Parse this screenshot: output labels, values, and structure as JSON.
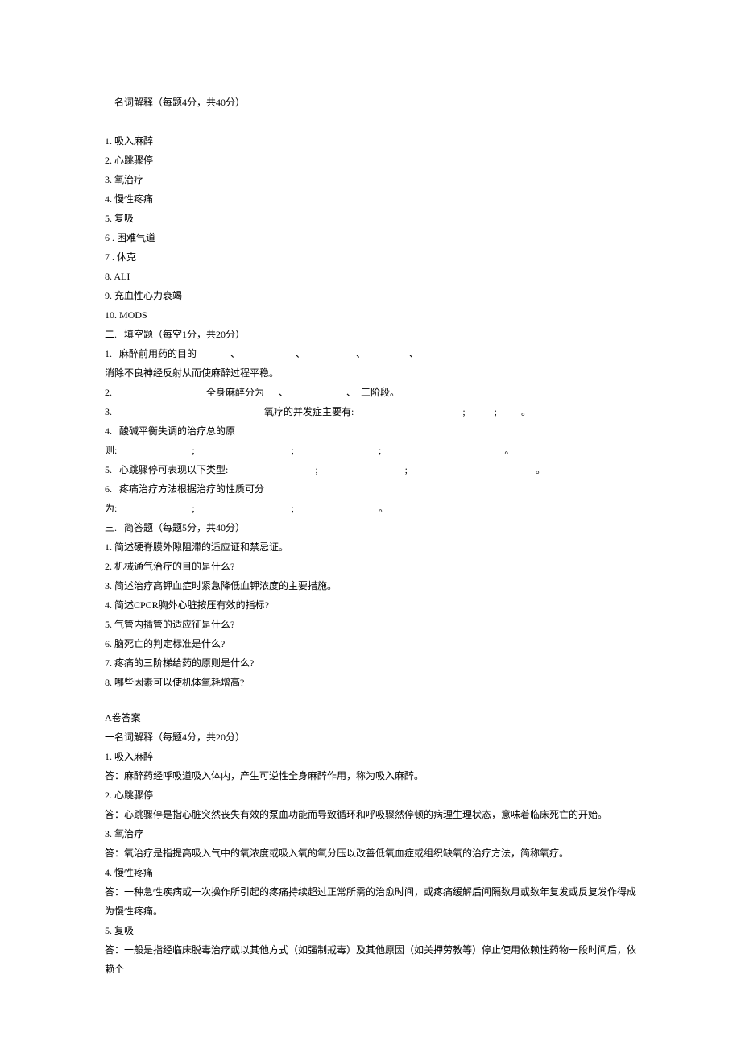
{
  "section1": {
    "header": "一名词解释（每题4分，共40分）",
    "items": [
      "1.   吸入麻醉",
      "2.    心跳骤停",
      "3.   氧治疗",
      "4.   慢性疼痛",
      "5.   复吸",
      "6   . 困难气道",
      "7   . 休克",
      "8.    ALI",
      "9.    充血性心力衰竭",
      "10.  MODS"
    ]
  },
  "section2": {
    "header": "二.   填空题（每空1分，共20分）",
    "items": [
      "1.   麻醉前用药的目的              、                       、                     、                  、",
      "消除不良神经反射从而使麻醉过程平稳。",
      "2.                                       全身麻醉分为      、                        、  三阶段。",
      "3.                                                               氧疗的并发症主要有:                                             ;            ;          。",
      "4.   酸碱平衡失调的治疗总的原",
      "则:                               ;                                        ;                                   ;                                                   。",
      "5.   心跳骤停可表现以下类型:                                    ;                                    ;                                                     。",
      "6.   疼痛治疗方法根据治疗的性质可分",
      "为:                               ;                                        ;                                   。"
    ]
  },
  "section3": {
    "header": "三.   简答题（每题5分，共40分）",
    "items": [
      "1.   简述硬脊膜外隙阻滞的适应证和禁忌证。",
      "2.   机械通气治疗的目的是什么?",
      "3.   简述治疗高钾血症时紧急降低血钾浓度的主要措施。",
      "4.    简述CPCR胸外心脏按压有效的指标?",
      "5.   气管内插管的适应征是什么?",
      "6.   脑死亡的判定标准是什么?",
      "7.    疼痛的三阶梯给药的原则是什么?",
      "8.    哪些因素可以使机体氧耗增高?"
    ]
  },
  "answers": {
    "header": "A卷答案",
    "subheader": "一名词解释（每题4分，共20分）",
    "items": [
      "1.   吸入麻醉",
      "答：麻醉药经呼吸道吸入体内，产生可逆性全身麻醉作用，称为吸入麻醉。",
      "2.    心跳骤停",
      "答：心跳骤停是指心脏突然丧失有效的泵血功能而导致循环和呼吸骤然停顿的病理生理状态，意味着临床死亡的开始。",
      "3.   氧治疗",
      "答：氧治疗是指提高吸入气中的氧浓度或吸入氧的氧分压以改善低氧血症或组织缺氧的治疗方法，简称氧疗。",
      "4.   慢性疼痛",
      "答：一种急性疾病或一次操作所引起的疼痛持续超过正常所需的治愈时间，或疼痛缓解后间隔数月或数年复发或反复发作得成  为慢性疼痛。",
      "5.   复吸",
      "答：一般是指经临床脱毒治疗或以其他方式（如强制戒毒）及其他原因（如关押劳教等）停止使用依赖性药物一段时间后，依  赖个"
    ]
  }
}
